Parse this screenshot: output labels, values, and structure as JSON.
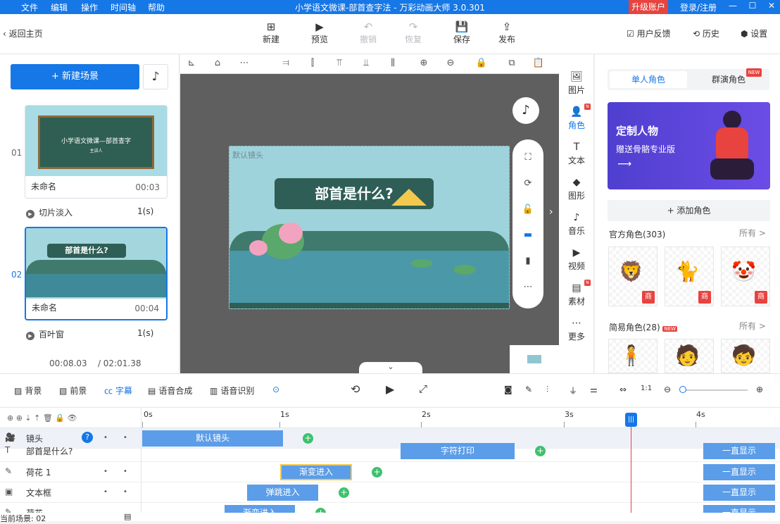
{
  "menu": [
    "文件",
    "编辑",
    "操作",
    "时间轴",
    "帮助"
  ],
  "window_title": "小学语文微课-部首查字法 - 万彩动画大师 3.0.301",
  "upgrade": "升级账户",
  "login": "登录/注册",
  "win": {
    "min": "—",
    "max": "☐",
    "close": "✕"
  },
  "back": "返回主页",
  "toolbar": [
    {
      "label": "新建",
      "icon": "⊞",
      "disabled": false
    },
    {
      "label": "预览",
      "icon": "▶",
      "disabled": false
    },
    {
      "label": "撤销",
      "icon": "↶",
      "disabled": true
    },
    {
      "label": "恢复",
      "icon": "↷",
      "disabled": true
    },
    {
      "label": "保存",
      "icon": "💾",
      "disabled": false
    },
    {
      "label": "发布",
      "icon": "⇪",
      "disabled": false
    }
  ],
  "toolbar_right": [
    "用户反馈",
    "历史",
    "设置"
  ],
  "left": {
    "new_scene": "+ 新建场景",
    "scenes": [
      {
        "num": "01",
        "thumb_title": "小学语文微课—部首查字",
        "thumb_sub": "主讲人",
        "name": "未命名",
        "dur": "00:03",
        "trans": "切片淡入",
        "trans_dur": "1(s)"
      },
      {
        "num": "02",
        "thumb_title": "部首是什么?",
        "name": "未命名",
        "dur": "00:04",
        "trans": "百叶窗",
        "trans_dur": "1(s)"
      }
    ],
    "current_time": "00:08.03",
    "total_time": "/ 02:01.38"
  },
  "canvas": {
    "camera_label": "默认镜头",
    "question": "部首是什么?"
  },
  "right_bar": [
    {
      "label": "图片",
      "icon": "🖼",
      "new": false
    },
    {
      "label": "角色",
      "icon": "👤",
      "new": true
    },
    {
      "label": "文本",
      "icon": "T",
      "new": false
    },
    {
      "label": "图形",
      "icon": "◆",
      "new": false
    },
    {
      "label": "音乐",
      "icon": "♪",
      "new": false
    },
    {
      "label": "视频",
      "icon": "▶",
      "new": false
    },
    {
      "label": "素材",
      "icon": "▤",
      "new": true
    },
    {
      "label": "更多",
      "icon": "⋯",
      "new": false
    }
  ],
  "right_panel": {
    "tabs": [
      "单人角色",
      "群演角色"
    ],
    "new_tag": "NEW",
    "banner_title": "定制人物",
    "banner_sub": "赠送骨骼专业版",
    "add_role": "+ 添加角色",
    "official": "官方角色(303)",
    "simple": "简易角色(28)",
    "more": "所有 >",
    "badge": "商",
    "simple_new": "NEW"
  },
  "timeline_tools": [
    "背景",
    "前景",
    "字幕",
    "语音合成",
    "语音识别"
  ],
  "ruler": [
    "0s",
    "1s",
    "2s",
    "3s",
    "4s"
  ],
  "tracks": [
    {
      "label": "镜头",
      "clip": "默认镜头",
      "icon": "🎥"
    },
    {
      "label": "部首是什么?",
      "clip": "字符打印",
      "end": "一直显示",
      "icon": "T"
    },
    {
      "label": "荷花 1",
      "clip": "渐变进入",
      "end": "一直显示",
      "icon": "✎"
    },
    {
      "label": "文本框",
      "clip": "弹跳进入",
      "end": "一直显示",
      "icon": "▣"
    },
    {
      "label": "荷花",
      "clip": "渐变进入",
      "end": "一直显示",
      "icon": "✎"
    }
  ],
  "status": "当前场景: 02",
  "colors": {
    "accent": "#1677e6",
    "danger": "#e8433f",
    "clip": "#5b9de8",
    "add": "#3ec16d"
  }
}
